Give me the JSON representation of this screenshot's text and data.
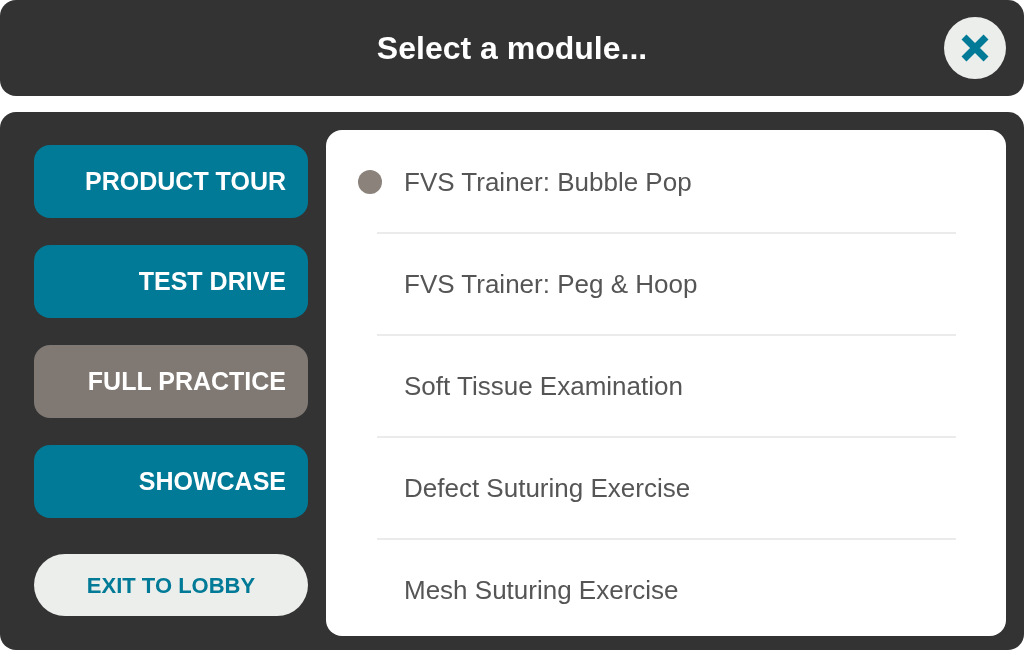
{
  "header": {
    "title": "Select a module..."
  },
  "categories": [
    {
      "label": "PRODUCT TOUR",
      "selected": false
    },
    {
      "label": "TEST DRIVE",
      "selected": false
    },
    {
      "label": "FULL PRACTICE",
      "selected": true
    },
    {
      "label": "SHOWCASE",
      "selected": false
    }
  ],
  "exit_button": {
    "label": "EXIT TO LOBBY"
  },
  "modules": [
    {
      "label": "FVS Trainer: Bubble Pop",
      "selected": true
    },
    {
      "label": "FVS Trainer: Peg & Hoop",
      "selected": false
    },
    {
      "label": "Soft Tissue Examination",
      "selected": false
    },
    {
      "label": "Defect Suturing Exercise",
      "selected": false
    },
    {
      "label": "Mesh Suturing Exercise",
      "selected": false
    }
  ]
}
